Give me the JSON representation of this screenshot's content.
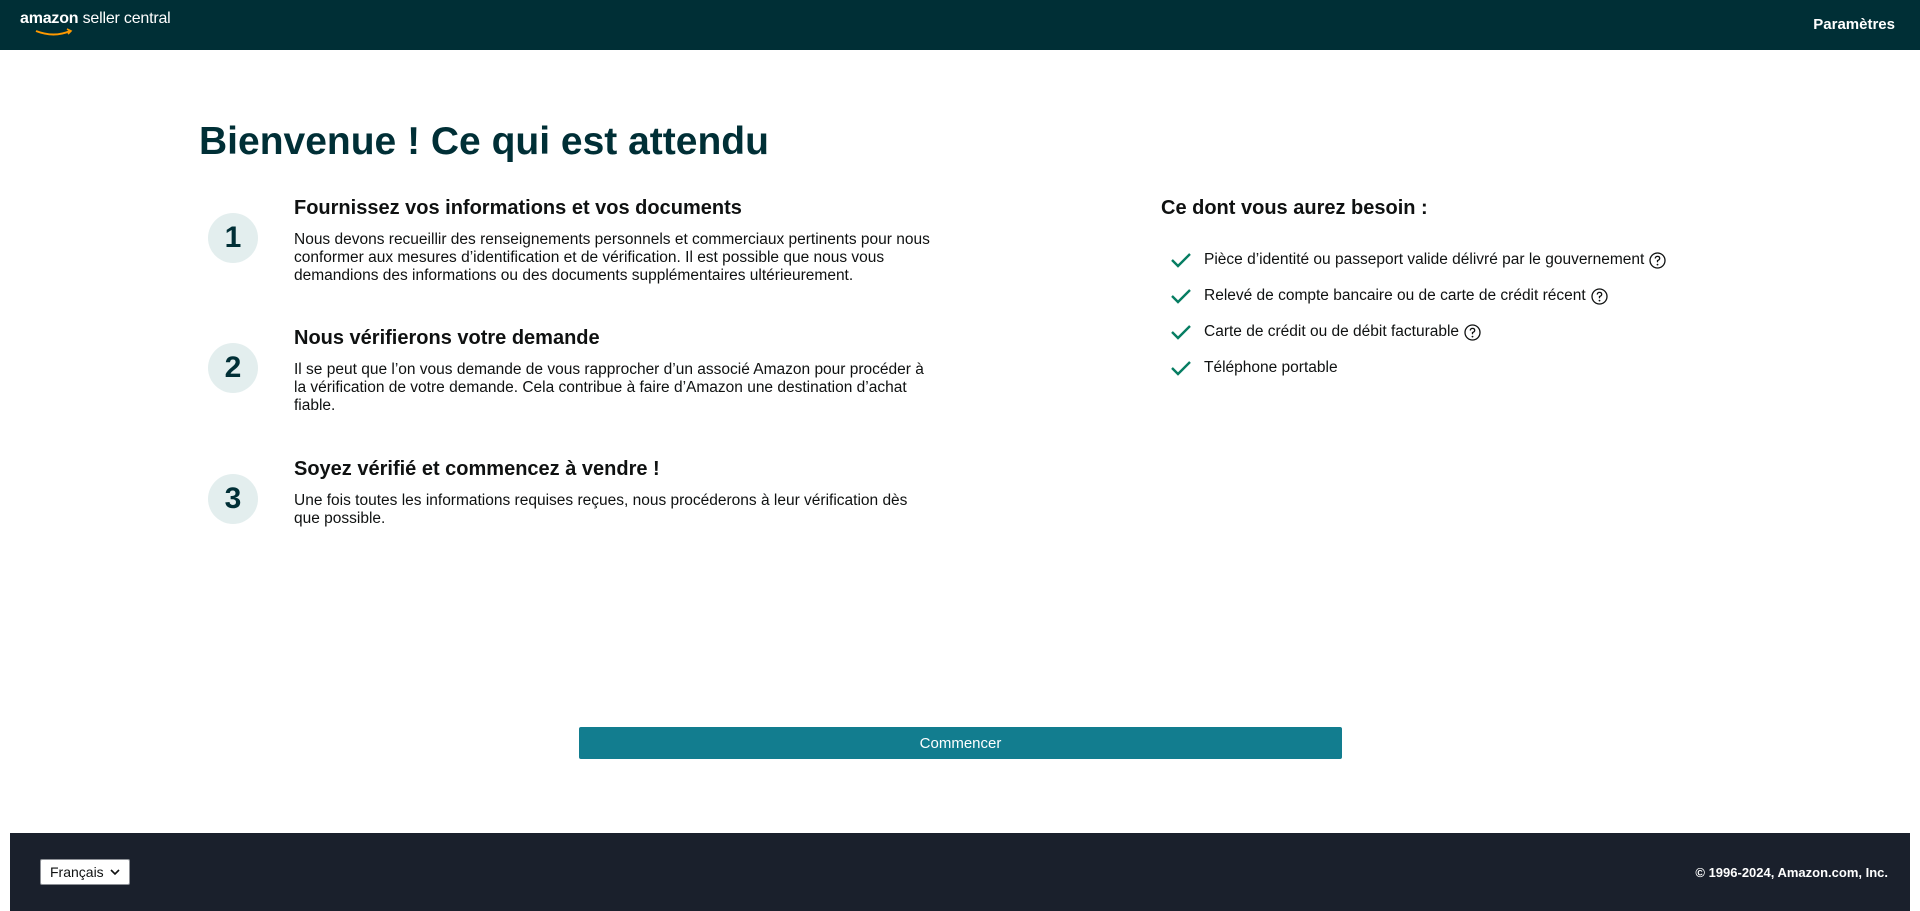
{
  "header": {
    "logo_brand": "amazon",
    "logo_product": "seller central",
    "settings_label": "Paramètres"
  },
  "page": {
    "title": "Bienvenue ! Ce qui est attendu"
  },
  "steps": [
    {
      "number": "1",
      "heading": "Fournissez vos informations et vos documents",
      "body": "Nous devons recueillir des renseignements personnels et commerciaux pertinents pour nous conformer aux mesures d’identification et de vérification. Il est possible que nous vous demandions des informations ou des documents supplémentaires ultérieurement."
    },
    {
      "number": "2",
      "heading": "Nous vérifierons votre demande",
      "body": "Il se peut que l’on vous demande de vous rapprocher d’un associé Amazon pour procéder à la vérification de votre demande. Cela contribue à faire d’Amazon une destination d’achat fiable."
    },
    {
      "number": "3",
      "heading": "Soyez vérifié et commencez à vendre !",
      "body": "Une fois toutes les informations requises reçues, nous procéderons à leur vérification dès que possible."
    }
  ],
  "needs": {
    "heading": "Ce dont vous aurez besoin :",
    "items": [
      {
        "label": "Pièce d’identité ou passeport valide délivré par le gouvernement",
        "icon": "check-icon",
        "help": true
      },
      {
        "label": "Relevé de compte bancaire ou de carte de crédit récent",
        "icon": "check-icon",
        "help": true
      },
      {
        "label": "Carte de crédit ou de débit facturable",
        "icon": "check-icon",
        "help": true
      },
      {
        "label": "Téléphone portable",
        "icon": "check-icon",
        "help": false
      }
    ]
  },
  "start_button_label": "Commencer",
  "footer": {
    "language_selected": "Français",
    "copyright": "© 1996-2024, Amazon.com, Inc."
  },
  "colors": {
    "header_bg": "#002f36",
    "accent_button": "#127d8f",
    "check_green": "#067d62",
    "footer_bg": "#1a202c",
    "step_circle_bg": "#e3eeee"
  }
}
